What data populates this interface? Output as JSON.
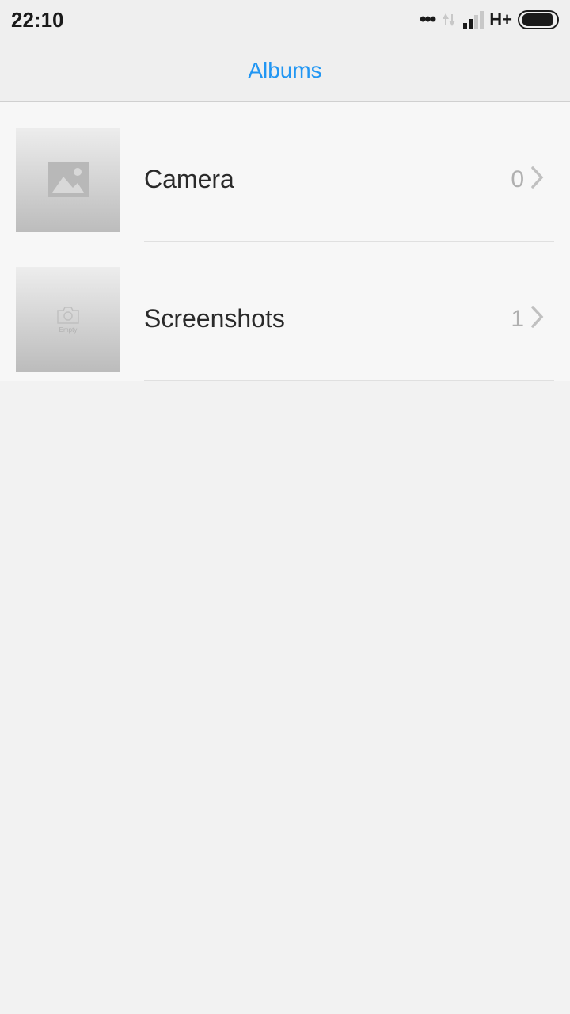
{
  "status_bar": {
    "time": "22:10",
    "network_label": "H+"
  },
  "header": {
    "title": "Albums"
  },
  "albums": [
    {
      "name": "Camera",
      "count": "0",
      "thumb_type": "image"
    },
    {
      "name": "Screenshots",
      "count": "1",
      "thumb_type": "camera"
    }
  ]
}
